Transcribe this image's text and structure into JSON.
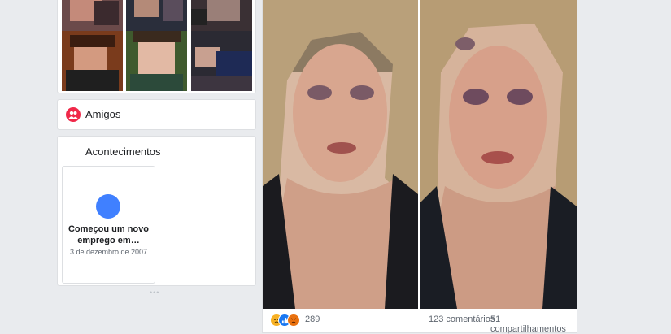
{
  "sidebar": {
    "photos": {
      "thumbnails": [
        "photo-thumb-1",
        "photo-thumb-2",
        "photo-thumb-3",
        "photo-thumb-4",
        "photo-thumb-5",
        "photo-thumb-6"
      ]
    },
    "friends": {
      "label": "Amigos",
      "icon": "friends-icon"
    },
    "events": {
      "title": "Acontecimentos",
      "items": [
        {
          "title": "Começou um novo emprego em…",
          "date": "3 de dezembro de 2007"
        }
      ],
      "more": "•••"
    }
  },
  "post": {
    "photos": [
      "post-photo-1",
      "post-photo-2"
    ],
    "reactions": {
      "icons": [
        "sad-reaction-icon",
        "like-reaction-icon",
        "angry-reaction-icon"
      ],
      "count": "289"
    },
    "comments": "123 comentários",
    "shares": "51 compartilhamentos"
  },
  "colors": {
    "page_bg": "#e9ebee",
    "card_border": "#dddfe2",
    "friends_badge": "#f02849",
    "event_dot": "#4080ff",
    "like_blue": "#1877f2",
    "sad_yellow": "#f7b125",
    "angry_orange": "#e9710f"
  }
}
